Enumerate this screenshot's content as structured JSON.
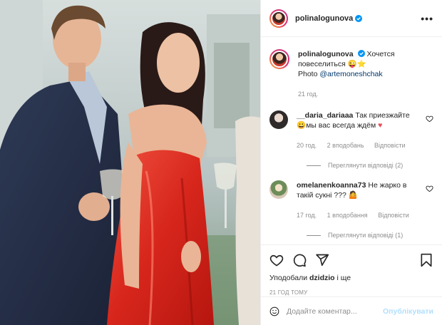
{
  "post": {
    "author": "polinalogunova",
    "caption_text": "Хочется повеселиться 😜⭐",
    "caption_photo_prefix": "Photo ",
    "caption_mention": "@artemoneshchak",
    "caption_time": "21 год."
  },
  "comments": [
    {
      "username": "__daria_dariaaa",
      "text": "Так приезжайте 😀мы вас всегда ждём",
      "emoji_end": "♥",
      "time": "20 год.",
      "likes": "2 вподобань",
      "reply": "Відповісти",
      "view_replies": "Переглянути відповіді (2)"
    },
    {
      "username": "omelanenkoanna73",
      "text": "Не жарко в такій сукні ??? 🤷",
      "time": "17 год.",
      "likes": "1 вподобання",
      "reply": "Відповісти",
      "view_replies": "Переглянути відповіді (1)"
    }
  ],
  "likes": {
    "prefix": "Уподобали ",
    "user": "dzidzio",
    "suffix": " і ще"
  },
  "timestamp": "21 ГОД ТОМУ",
  "composer": {
    "placeholder": "Додайте коментар...",
    "publish": "Опублікувати"
  },
  "header": {
    "more": "•••"
  },
  "icons": {
    "like": "heart-icon",
    "comment": "comment-icon",
    "share": "share-icon",
    "save": "bookmark-icon",
    "emoji": "emoji-icon",
    "verified": "verified-badge-icon"
  },
  "colors": {
    "verified": "#0095f6",
    "link": "#00376b",
    "muted": "#8e8e8e",
    "publish_disabled": "#b2dffc",
    "heart_red": "#ed4956"
  }
}
